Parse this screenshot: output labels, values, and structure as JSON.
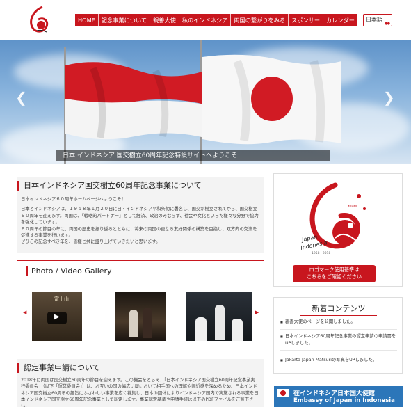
{
  "header": {
    "nav": [
      "HOME",
      "記念事業について",
      "親善大使",
      "私のインドネシア",
      "両国の繋がりをみる",
      "スポンサー",
      "カレンダー"
    ],
    "language": "日本語"
  },
  "hero": {
    "caption": "日本 インドネシア 国交樹立60周年記念特設サイトへようこそ"
  },
  "welcome": {
    "title": "日本インドネシア国交樹立60周年記念事業について",
    "p1": "日本インドネシア６０周年ホームページへようこそ！",
    "p2": "日本とインドネシアは、１９５８年１月２０日に日・インドネシア平和条約に署名し、国交が樹立されてから、国交樹立６０周年を迎えます。両国は、「戦略的パートナー」として経済、政治のみならず、社会や文化といった様々な分野で協力を強化しています。",
    "p3": "６０周年の節目の年に、両国の歴史を振り返るとともに、将来の両国の更なる友好関係の構築を目指し、双方向の交流を促進する事業を行います。",
    "p4": "ぜひこの記念すべき年を、皆様と共に盛り上げていきたいと思います。"
  },
  "gallery": {
    "title": "Photo / Video Gallery",
    "thumb1_text": "富士山"
  },
  "recognition": {
    "title": "認定事業申請について",
    "p1": "2018年に両国は国交樹立60周年の節目を迎えます。この機会をとらえ、「日本インドネシア国交樹立60周年記念事業実行委員会」（以下「運営委員会」）は、お互いの国の幅広い層において相手国への理解や親近感を深めるため、日本インドネシア国交樹立60周年の趣旨にふさわしい事業を広く募集し、日本の団体によりインドネシア国内で実施される事業を日本インドネシア国交樹立60周年記念事業として認定します。事業認定基準や申請手続は以下のPDFファイルをご覧下さい。"
  },
  "sidebar": {
    "logo_text_1": "Japan",
    "logo_text_2": "Indonesia",
    "logo_years": "1958 - 2018",
    "logo_badge": "Years",
    "logo_button": [
      "ロゴマーク使用基準は",
      "こちらをご確認ください"
    ],
    "news_title": "新着コンテンツ",
    "news": [
      "親善大使のページを公開しました。",
      "日本インドネシア60周年記念事業の認定申請の申請書をUPしました。",
      "Jakarta Japan Matsuriの写真をUPしました。"
    ],
    "embassy_line1": "在インドネシア日本国大使館",
    "embassy_line2": "Embassy of Japan in Indonesia"
  },
  "colors": {
    "accent": "#c8161e",
    "sky": "#87b2dc",
    "embassy_blue": "#2c76b9"
  }
}
